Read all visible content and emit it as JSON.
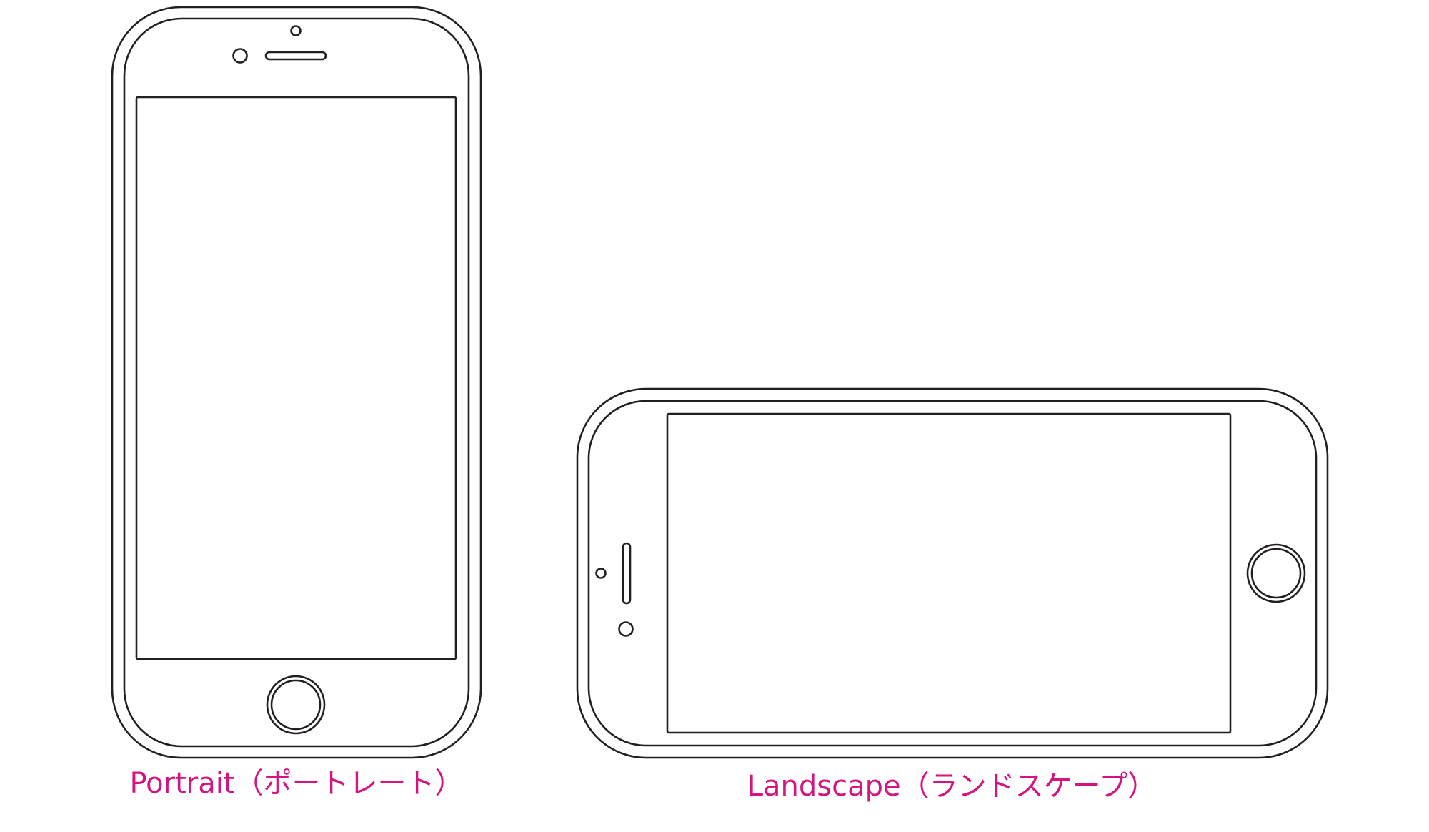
{
  "colors": {
    "outline": "#231f20",
    "caption": "#d4157f",
    "background": "#ffffff"
  },
  "devices": {
    "portrait": {
      "caption": "Portrait（ポートレート）"
    },
    "landscape": {
      "caption": "Landscape（ランドスケープ）"
    }
  }
}
